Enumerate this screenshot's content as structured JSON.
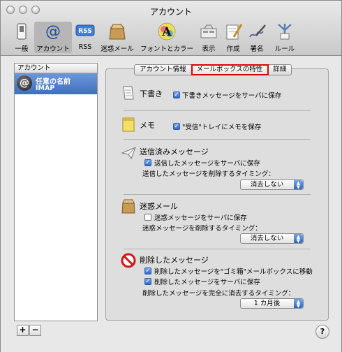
{
  "window": {
    "title": "アカウント"
  },
  "toolbar": [
    {
      "label": "一般",
      "icon": "switch-icon"
    },
    {
      "label": "アカウント",
      "icon": "at-sign-icon",
      "selected": true
    },
    {
      "label": "RSS",
      "icon": "rss-icon"
    },
    {
      "label": "迷惑メール",
      "icon": "junk-mail-icon"
    },
    {
      "label": "フォントとカラー",
      "icon": "font-color-icon"
    },
    {
      "label": "表示",
      "icon": "view-icon"
    },
    {
      "label": "作成",
      "icon": "compose-icon"
    },
    {
      "label": "署名",
      "icon": "signature-icon"
    },
    {
      "label": "ルール",
      "icon": "rules-icon"
    }
  ],
  "accounts": {
    "header": "アカウント",
    "items": [
      {
        "name": "任意の名前",
        "type": "IMAP"
      }
    ],
    "add_label": "+",
    "remove_label": "−"
  },
  "tabs": [
    {
      "label": "アカウント情報"
    },
    {
      "label": "メールボックスの特性",
      "active": true
    },
    {
      "label": "詳細"
    }
  ],
  "drafts": {
    "title": "下書き",
    "option": "下書きメッセージをサーバに保存",
    "checked": true
  },
  "notes": {
    "title": "メモ",
    "option": "\"受信\"トレイにメモを保存",
    "checked": true
  },
  "sent": {
    "title": "送信済みメッセージ",
    "option": "送信したメッセージをサーバに保存",
    "checked": true,
    "delete_label": "送信したメッセージを削除するタイミング：",
    "delete_value": "消去しない"
  },
  "junk": {
    "title": "迷惑メール",
    "option": "迷惑メッセージをサーバに保存",
    "checked": false,
    "delete_label": "迷惑メッセージを削除するタイミング：",
    "delete_value": "消去しない"
  },
  "trash": {
    "title": "削除したメッセージ",
    "option1": "削除したメッセージを\"ゴミ箱\"メールボックスに移動",
    "option1_checked": true,
    "option2": "削除したメッセージをサーバに保存",
    "option2_checked": true,
    "erase_label": "削除したメッセージを完全に消去するタイミング：",
    "erase_value": "1 カ月後"
  },
  "help_label": "?",
  "colors": {
    "selection": "#3f6fbd",
    "highlight": "#e00000",
    "popup_arrow": "#2d64c2"
  }
}
